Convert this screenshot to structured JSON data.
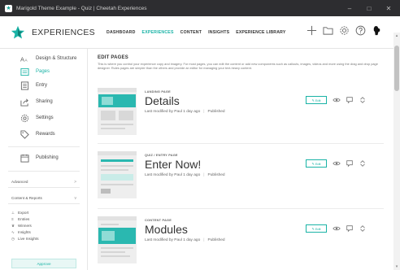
{
  "window": {
    "title": "Marigold Theme Example - Quiz | Cheetah Experiences",
    "controls": {
      "minimize": "–",
      "maximize": "□",
      "close": "✕"
    }
  },
  "header": {
    "brand": "EXPERIENCES",
    "nav": [
      "DASHBOARD",
      "EXPERIENCES",
      "CONTENT",
      "INSIGHTS",
      "EXPERIENCE LIBRARY"
    ],
    "active_nav": "EXPERIENCES",
    "icons": [
      "plus-icon",
      "folder-icon",
      "gear-icon",
      "help-icon",
      "user-icon"
    ]
  },
  "sidebar": {
    "items": [
      {
        "label": "Design & Structure",
        "icon": "design-icon"
      },
      {
        "label": "Pages",
        "icon": "pages-icon",
        "active": true
      },
      {
        "label": "Entry",
        "icon": "entry-icon"
      },
      {
        "label": "Sharing",
        "icon": "share-icon"
      },
      {
        "label": "Settings",
        "icon": "gear-icon"
      },
      {
        "label": "Rewards",
        "icon": "tag-icon"
      }
    ],
    "publishing": {
      "label": "Publishing",
      "icon": "calendar-icon"
    },
    "advanced": {
      "label": "Advanced",
      "chevron": ">"
    },
    "content_reports": {
      "label": "Content & Reports",
      "chevron": "v"
    },
    "reports": [
      {
        "label": "Export",
        "icon": "⊥"
      },
      {
        "label": "Entries",
        "icon": "≡"
      },
      {
        "label": "Winners",
        "icon": "♛"
      },
      {
        "label": "Insights",
        "icon": "∿"
      },
      {
        "label": "Live Insights",
        "icon": "◷"
      }
    ],
    "approve_label": "Approve"
  },
  "main": {
    "title": "EDIT PAGES",
    "description": "This is where you control your experience copy and imagery. For most pages, you can edit the content or add new components such as callouts, images, videos and more using the drag and drop page designer. Rules pages are simpler than the others and provide an editor for managing your text-heavy content.",
    "cards": [
      {
        "type": "LANDING PAGE",
        "title": "Details",
        "modified": "Last modified by Paul 1 day ago",
        "status": "Published",
        "edit": "Edit"
      },
      {
        "type": "QUIZ / ENTRY PAGE",
        "title": "Enter Now!",
        "modified": "Last modified by Paul 1 day ago",
        "status": "Published",
        "edit": "Edit"
      },
      {
        "type": "CONTENT PAGE",
        "title": "Modules",
        "modified": "Last modified by Paul 1 day ago",
        "status": "Published",
        "edit": "Edit"
      }
    ]
  },
  "colors": {
    "accent": "#1ab3a6",
    "titlebar": "#2d2d30"
  }
}
